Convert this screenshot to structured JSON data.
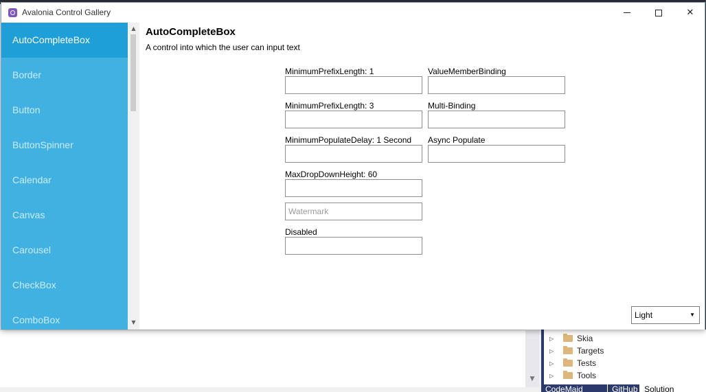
{
  "window": {
    "title": "Avalonia Control Gallery",
    "close_symbol": "✕"
  },
  "sidebar": {
    "items": [
      {
        "label": "AutoCompleteBox"
      },
      {
        "label": "Border"
      },
      {
        "label": "Button"
      },
      {
        "label": "ButtonSpinner"
      },
      {
        "label": "Calendar"
      },
      {
        "label": "Canvas"
      },
      {
        "label": "Carousel"
      },
      {
        "label": "CheckBox"
      },
      {
        "label": "ComboBox"
      }
    ],
    "selected_index": 0,
    "scroll_up_symbol": "▲",
    "scroll_down_symbol": "▼"
  },
  "page": {
    "title": "AutoCompleteBox",
    "description": "A control into which the user can input text"
  },
  "fields": {
    "min_prefix_1": {
      "label": "MinimumPrefixLength: 1",
      "value": ""
    },
    "value_member": {
      "label": "ValueMemberBinding",
      "value": ""
    },
    "min_prefix_3": {
      "label": "MinimumPrefixLength: 3",
      "value": ""
    },
    "multi_binding": {
      "label": "Multi-Binding",
      "value": ""
    },
    "min_delay": {
      "label": "MinimumPopulateDelay: 1 Second",
      "value": ""
    },
    "async_populate": {
      "label": "Async Populate",
      "value": ""
    },
    "max_dropdown": {
      "label": "MaxDropDownHeight: 60",
      "value": ""
    },
    "watermark": {
      "placeholder": "Watermark",
      "value": ""
    },
    "disabled": {
      "label": "Disabled",
      "value": ""
    }
  },
  "theme": {
    "selected": "Light",
    "arrow": "▼"
  },
  "background_ide": {
    "tree_items": [
      "Skia",
      "Targets",
      "Tests",
      "Tools"
    ],
    "tree_arrow": "▷",
    "scroll_arrow": "▼",
    "tabs": [
      "CodeMaid Spade",
      "GitHub",
      "Solution Explorer"
    ]
  },
  "colors": {
    "sidebar": "#41b1e1",
    "sidebar_selected": "#1f9fd8",
    "accent_icon": "#7d55c7"
  }
}
